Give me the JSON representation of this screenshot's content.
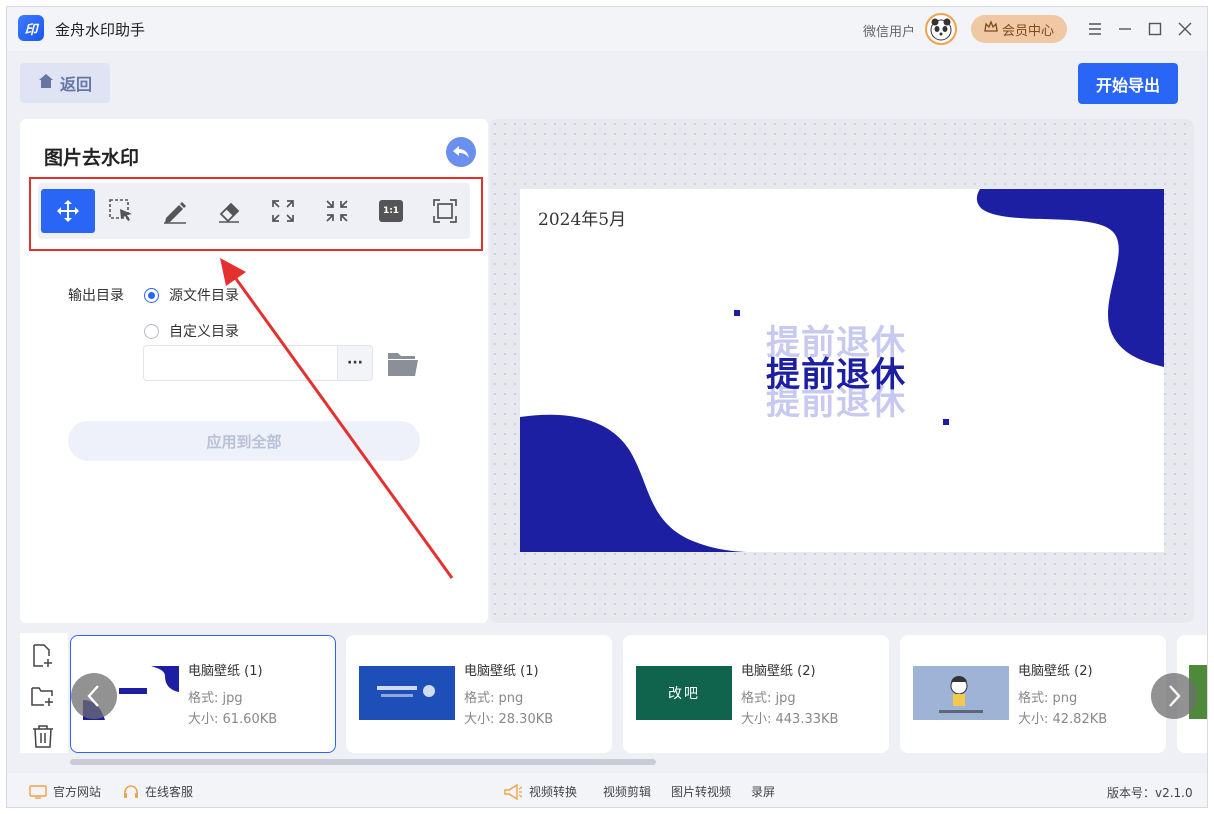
{
  "titlebar": {
    "app_title": "金舟水印助手",
    "logo_text": "印",
    "user_name": "微信用户",
    "member_label": "会员中心"
  },
  "toolbar": {
    "back_label": "返回",
    "export_label": "开始导出"
  },
  "left_panel": {
    "title": "图片去水印",
    "tools": [
      "move",
      "select",
      "brush",
      "eraser",
      "zoom-in",
      "zoom-out",
      "actual-size",
      "fit-screen"
    ],
    "actual_size_label": "1:1",
    "output_label": "输出目录",
    "option_source": "源文件目录",
    "option_custom": "自定义目录",
    "path_value": "",
    "more_label": "···",
    "apply_label": "应用到全部"
  },
  "preview": {
    "date_text": "2024年5月",
    "headline": "提前退休",
    "accent_color": "#1d1fa3"
  },
  "files": [
    {
      "name": "电脑壁纸 (1)",
      "format": "格式: jpg",
      "size": "大小: 61.60KB",
      "selected": true
    },
    {
      "name": "电脑壁纸 (1)",
      "format": "格式: png",
      "size": "大小: 28.30KB",
      "selected": false
    },
    {
      "name": "电脑壁纸 (2)",
      "format": "格式: jpg",
      "size": "大小: 443.33KB",
      "selected": false
    },
    {
      "name": "电脑壁纸 (2)",
      "format": "格式: png",
      "size": "大小: 42.82KB",
      "selected": false
    }
  ],
  "thumbs": {
    "card3_text": "改吧"
  },
  "footer": {
    "website": "官方网站",
    "support": "在线客服",
    "video_convert": "视频转换",
    "video_edit": "视频剪辑",
    "img_to_video": "图片转视频",
    "record": "录屏",
    "version": "版本号：v2.1.0"
  }
}
